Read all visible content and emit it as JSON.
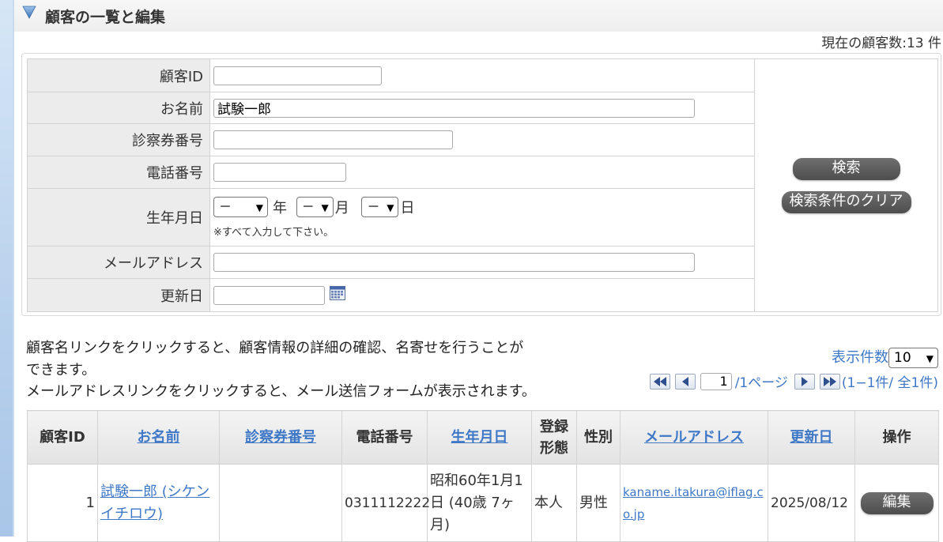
{
  "header": {
    "title": "顧客の一覧と編集",
    "customer_count": "現在の顧客数:13 件"
  },
  "search": {
    "customer_id_label": "顧客ID",
    "customer_id_value": "",
    "name_label": "お名前",
    "name_value": "試験一郎",
    "ticket_label": "診察券番号",
    "ticket_value": "",
    "phone_label": "電話番号",
    "phone_value": "",
    "birthdate_label": "生年月日",
    "year_select": "－",
    "year_unit": "年",
    "month_select": "－",
    "month_unit": "月",
    "day_select": "－",
    "day_unit": "日",
    "birthdate_note": "※すべて入力して下さい。",
    "email_label": "メールアドレス",
    "email_value": "",
    "updated_label": "更新日",
    "updated_value": "",
    "search_button": "検索",
    "clear_button": "検索条件のクリア"
  },
  "help": {
    "line1": "顧客名リンクをクリックすると、顧客情報の詳細の確認、名寄せを行うことが",
    "line2": "できます。",
    "line3": "メールアドレスリンクをクリックすると、メール送信フォームが表示されます。"
  },
  "display_count": {
    "label": "表示件数",
    "value": "10"
  },
  "pager": {
    "page_value": "1",
    "page_total": "/1ページ",
    "range": "(1−1件/ 全1件)"
  },
  "table": {
    "headers": {
      "id": "顧客ID",
      "name": "お名前",
      "ticket": "診察券番号",
      "phone": "電話番号",
      "birthdate": "生年月日",
      "registration_line1": "登録",
      "registration_line2": "形態",
      "gender": "性別",
      "email": "メールアドレス",
      "updated": "更新日",
      "action": "操作"
    },
    "rows": [
      {
        "id": "1",
        "name": "試験一郎 (シケンイチロウ)",
        "ticket": "",
        "phone": "0311112222",
        "birthdate": "昭和60年1月1日 (40歳 7ヶ月)",
        "registration": "本人",
        "gender": "男性",
        "email": "kaname.itakura@iflag.co.jp",
        "updated": "2025/08/12",
        "edit_button": "編集"
      }
    ]
  },
  "colors": {
    "link": "#3e78c7",
    "button_dark": "#555555",
    "label_bg": "#ececec"
  }
}
